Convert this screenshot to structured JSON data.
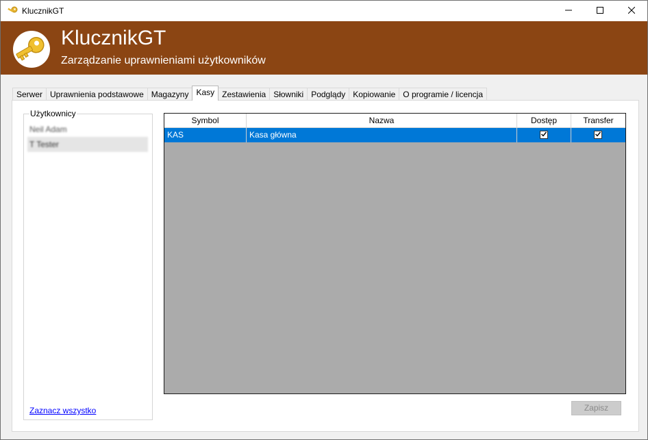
{
  "window": {
    "title": "KlucznikGT",
    "controls": {
      "minimize": "minimize-icon",
      "maximize": "maximize-icon",
      "close": "close-icon"
    }
  },
  "header": {
    "app_name": "KlucznikGT",
    "subtitle": "Zarządzanie uprawnieniami użytkowników",
    "background_color": "#8b4513",
    "logo_icon": "key-icon"
  },
  "tabs": [
    {
      "label": "Serwer",
      "active": false
    },
    {
      "label": "Uprawnienia podstawowe",
      "active": false
    },
    {
      "label": "Magazyny",
      "active": false
    },
    {
      "label": "Kasy",
      "active": true
    },
    {
      "label": "Zestawienia",
      "active": false
    },
    {
      "label": "Słowniki",
      "active": false
    },
    {
      "label": "Podglądy",
      "active": false
    },
    {
      "label": "Kopiowanie",
      "active": false
    },
    {
      "label": "O programie / licencja",
      "active": false
    }
  ],
  "users": {
    "group_label": "Użytkownicy",
    "items": [
      {
        "name": "Neil Adam",
        "selected": false
      },
      {
        "name": "T Tester",
        "selected": true
      }
    ],
    "select_all_label": "Zaznacz wszystko"
  },
  "grid": {
    "columns": [
      "Symbol",
      "Nazwa",
      "Dostęp",
      "Transfer"
    ],
    "rows": [
      {
        "symbol": "KAS",
        "nazwa": "Kasa główna",
        "dostep": true,
        "transfer": true,
        "selected": true
      }
    ],
    "selection_color": "#0078d7"
  },
  "actions": {
    "save_label": "Zapisz",
    "save_enabled": false
  }
}
